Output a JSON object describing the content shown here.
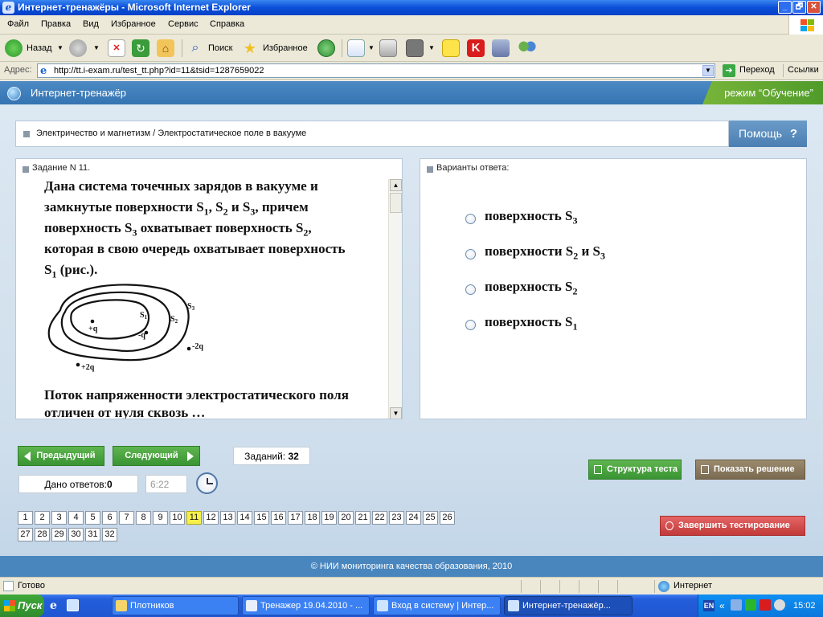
{
  "window": {
    "title": "Интернет-тренажёры - Microsoft Internet Explorer",
    "app_icon": "ie-icon",
    "buttons": [
      "_",
      "🗗",
      "✕"
    ]
  },
  "menu": [
    "Файл",
    "Правка",
    "Вид",
    "Избранное",
    "Сервис",
    "Справка"
  ],
  "toolbar": {
    "back_label": "Назад",
    "search_label": "Поиск",
    "favorites_label": "Избранное"
  },
  "address": {
    "label": "Адрес:",
    "url": "http://tt.i-exam.ru/test_tt.php?id=11&tsid=1287659022",
    "go_label": "Переход",
    "links_label": "Ссылки"
  },
  "app": {
    "title": "Интернет-тренажёр",
    "mode": "режим “Обучение”",
    "breadcrumb": "Электричество и магнетизм / Электростатическое поле в вакууме",
    "help_label": "Помощь",
    "help_glyph": "?",
    "task_header": "Задание N 11.",
    "answers_header": "Варианты ответа:",
    "question_lines": [
      {
        "parts": [
          "Дана система точечных зарядов в вакууме и"
        ]
      },
      {
        "parts": [
          "замкнутые поверхности S",
          "1",
          ", S",
          "2",
          " и S",
          "3",
          ", причем"
        ]
      },
      {
        "parts": [
          "поверхность S",
          "3",
          " охватывает поверхность S",
          "2",
          ","
        ]
      },
      {
        "parts": [
          "которая в свою очередь охватывает поверхность"
        ]
      },
      {
        "parts": [
          "S",
          "1",
          " (рис.)."
        ]
      }
    ],
    "question_tail": [
      "Поток напряженности электростатического поля",
      "отличен от нуля",
      " сквозь …"
    ],
    "figure_labels": {
      "plus_q": "+q",
      "minus_q": "-q",
      "minus_2q": "-2q",
      "plus_2q": "+2q",
      "s1": "S",
      "s1_sub": "1",
      "s2": "S",
      "s2_sub": "2",
      "s3": "S",
      "s3_sub": "3"
    },
    "options": [
      {
        "text": "поверхность S",
        "sub": "3",
        "tail": ""
      },
      {
        "text": "поверхности S",
        "sub": "2",
        "tail": " и S",
        "sub2": "3"
      },
      {
        "text": "поверхность S",
        "sub": "2",
        "tail": ""
      },
      {
        "text": "поверхность S",
        "sub": "1",
        "tail": ""
      }
    ],
    "prev_label": "Предыдущий",
    "next_label": "Следующий",
    "tasks_count_label": "Заданий:",
    "tasks_count": "32",
    "answered_label": "Дано ответов:",
    "answered_count": "0",
    "timer": "6:22",
    "structure_label": "Структура теста",
    "solution_label": "Показать решение",
    "finish_label": "Завершить тестирование",
    "current_page": 11,
    "pages": [
      "1",
      "2",
      "3",
      "4",
      "5",
      "6",
      "7",
      "8",
      "9",
      "10",
      "11",
      "12",
      "13",
      "14",
      "15",
      "16",
      "17",
      "18",
      "19",
      "20",
      "21",
      "22",
      "23",
      "24",
      "25",
      "26",
      "27",
      "28",
      "29",
      "30",
      "31",
      "32"
    ],
    "footer": "© НИИ мониторинга качества образования, 2010"
  },
  "status": {
    "left": "Готово",
    "zone": "Интернет"
  },
  "taskbar": {
    "start_label": "Пуск",
    "tasks": [
      {
        "label": "Плотников",
        "icon": "folder-icon"
      },
      {
        "label": "Тренажер 19.04.2010 - ...",
        "icon": "word-icon"
      },
      {
        "label": "Вход в систему | Интер...",
        "icon": "ie-icon"
      },
      {
        "label": "Интернет-тренажёр...",
        "icon": "ie-icon"
      }
    ],
    "lang": "EN",
    "clock": "15:02"
  },
  "colors": {
    "ie_blue": "#0a4ed8",
    "app_header": "#3474b2",
    "mode_green": "#4f9b2a",
    "nav_green": "#3a9433",
    "finish_red": "#c23a3a",
    "current_page_yellow": "#f7f04a"
  }
}
